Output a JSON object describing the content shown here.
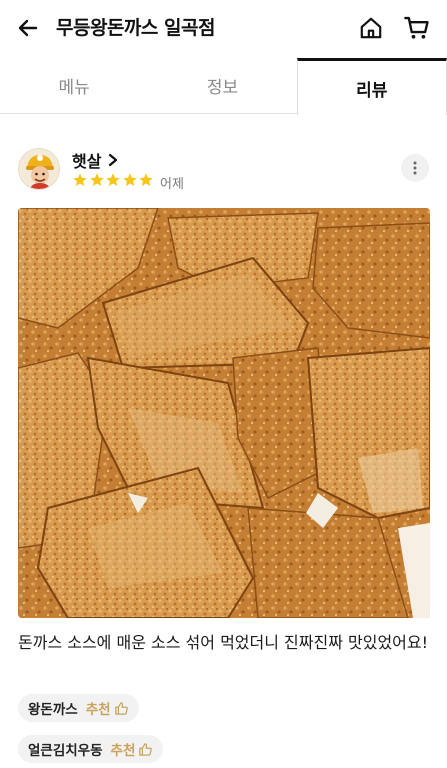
{
  "header": {
    "title": "무등왕돈까스 일곡점",
    "back_icon": "arrow-left-icon",
    "home_icon": "home-icon",
    "cart_icon": "cart-icon"
  },
  "tabs": [
    {
      "label": "메뉴",
      "active": false
    },
    {
      "label": "정보",
      "active": false
    },
    {
      "label": "리뷰",
      "active": true
    }
  ],
  "review": {
    "nickname": "햇살",
    "rating": 5,
    "max_rating": 5,
    "date": "어제",
    "text": "돈까스 소스에 매운 소스 섞어 먹었더니 진짜진짜 맛있었어요!",
    "menus": [
      {
        "name": "왕돈까스",
        "recommend": "추천"
      },
      {
        "name": "얼큰김치우동",
        "recommend": "추천"
      }
    ]
  },
  "colors": {
    "star": "#f5c518",
    "recommend": "#c9a25b",
    "active_tab_border": "#111111"
  }
}
